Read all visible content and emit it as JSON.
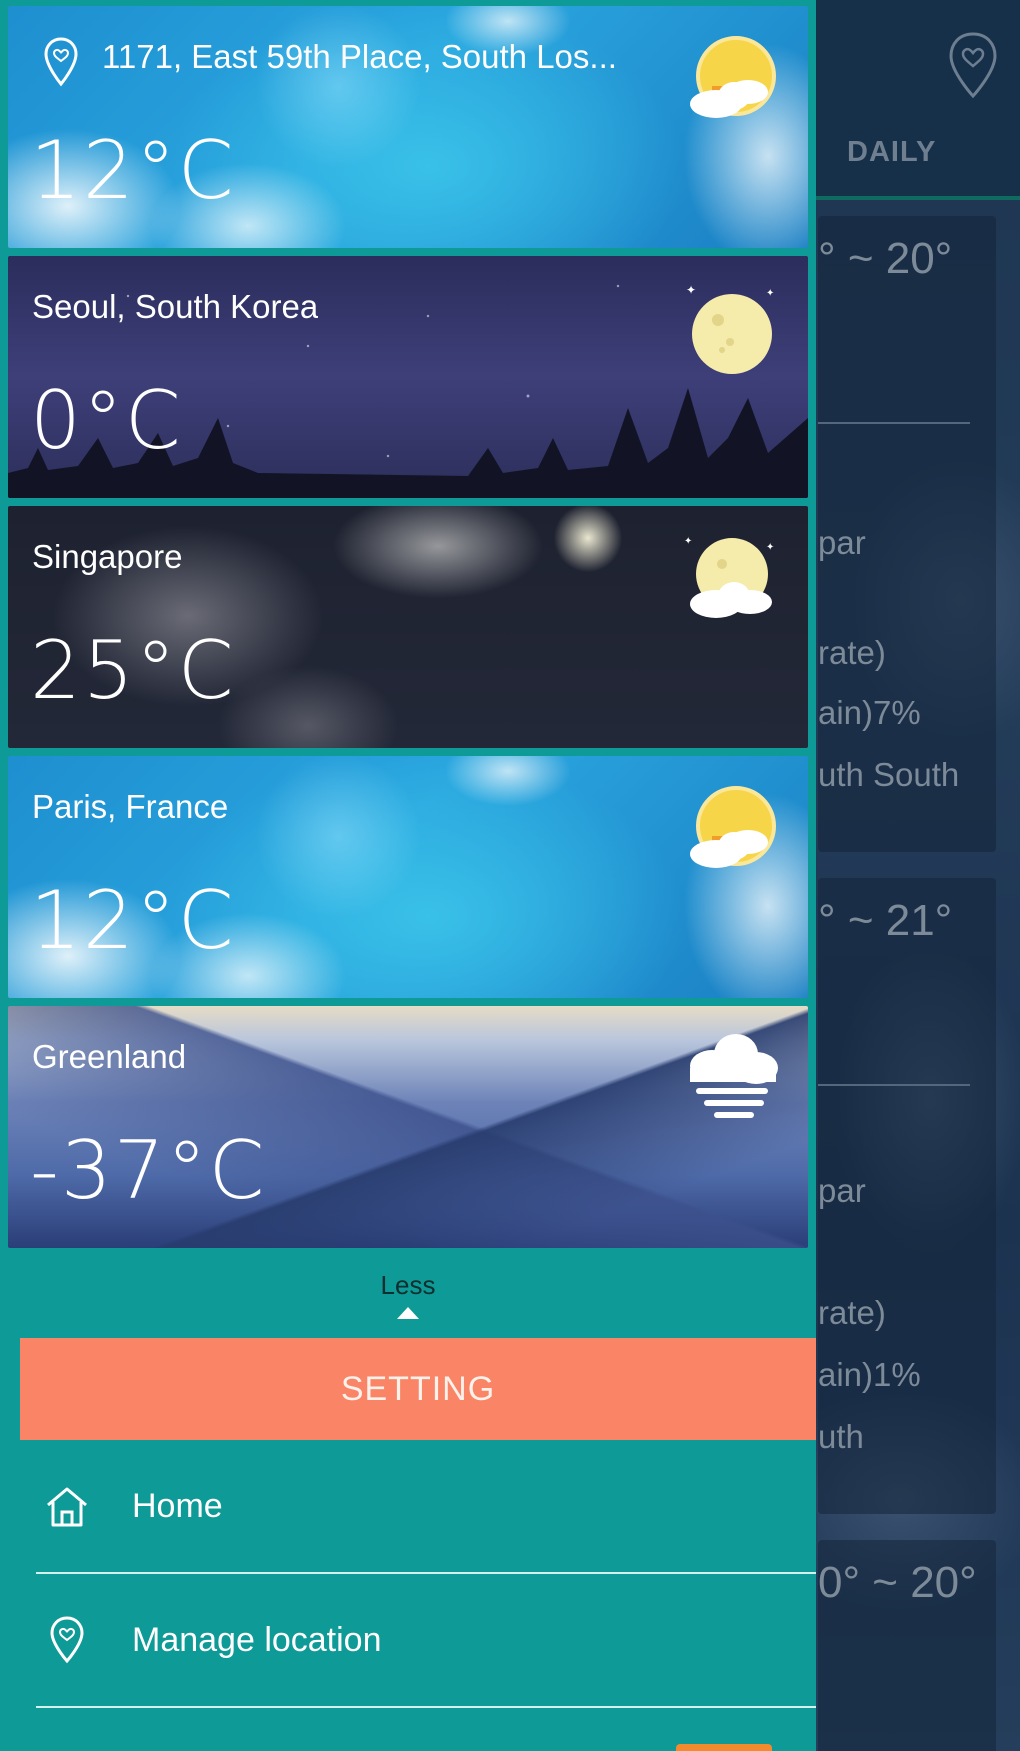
{
  "background_app": {
    "tab_daily": "DAILY",
    "days": [
      {
        "range": "° ~ 20°",
        "lines": [
          "par",
          "rate)",
          "ain)7%",
          "uth South"
        ]
      },
      {
        "range": "° ~ 21°",
        "lines": [
          "par",
          "rate)",
          "ain)1%",
          "uth"
        ]
      },
      {
        "range": "0° ~ 20°",
        "lines": []
      }
    ]
  },
  "drawer": {
    "locations": [
      {
        "name": "1171, East 59th Place, South Los...",
        "temp": "12°C",
        "condition_icon": "sun-cloud-icon",
        "current": true
      },
      {
        "name": "Seoul, South Korea",
        "temp": "0°C",
        "condition_icon": "moon-icon"
      },
      {
        "name": "Singapore",
        "temp": "25°C",
        "condition_icon": "moon-cloud-icon"
      },
      {
        "name": "Paris, France",
        "temp": "12°C",
        "condition_icon": "sun-cloud-icon"
      },
      {
        "name": "Greenland",
        "temp": "-37°C",
        "condition_icon": "fog-cloud-icon"
      }
    ],
    "less_label": "Less",
    "setting_label": "SETTING",
    "menu": [
      {
        "label": "Home",
        "icon": "home-icon"
      },
      {
        "label": "Manage location",
        "icon": "location-pin-icon"
      }
    ]
  },
  "colors": {
    "drawer_bg": "#0e9a96",
    "setting_button": "#fa8566",
    "accent_badge": "#f28a2e"
  }
}
